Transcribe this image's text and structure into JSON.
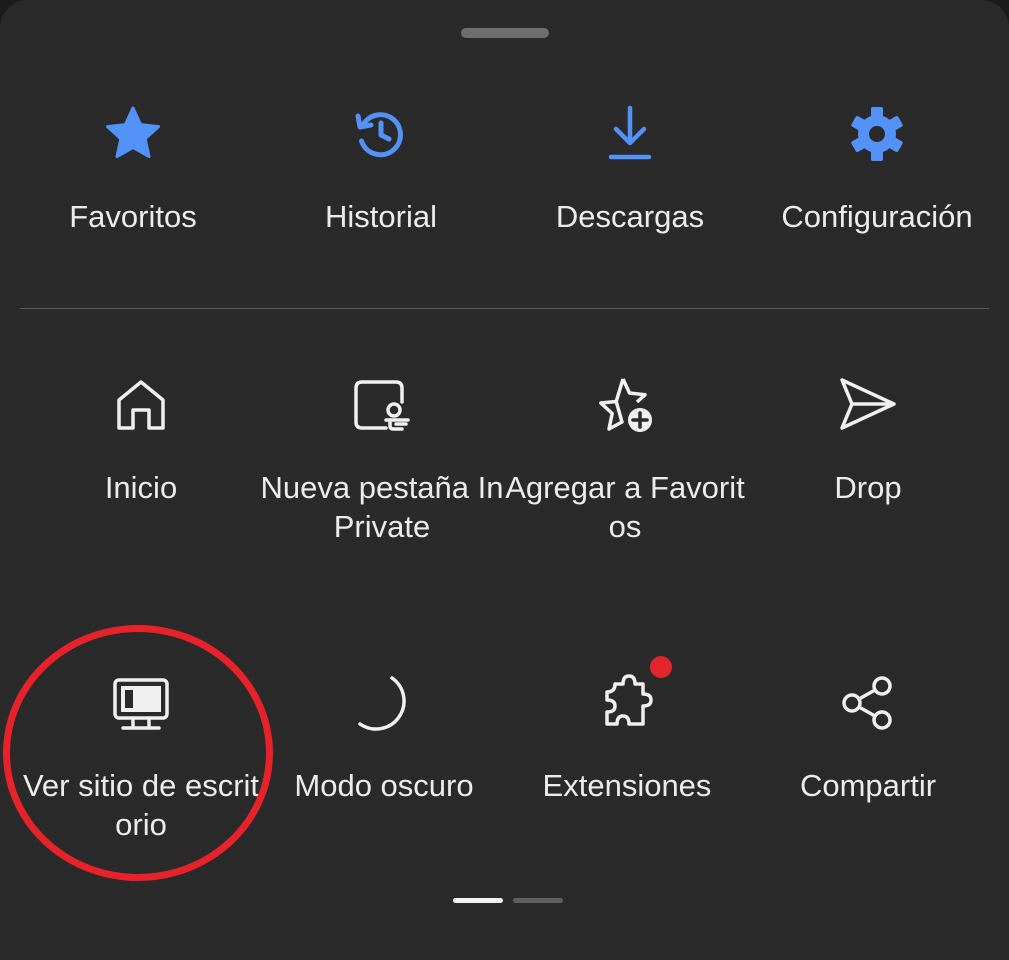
{
  "colors": {
    "accent": "#5392f6",
    "background": "#2a2a2b",
    "text": "#ececec",
    "badge": "#e2242b",
    "highlight": "#e8222b"
  },
  "row1": {
    "favorites": {
      "label": "Favoritos",
      "icon": "star-icon"
    },
    "history": {
      "label": "Historial",
      "icon": "history-icon"
    },
    "downloads": {
      "label": "Descargas",
      "icon": "download-icon"
    },
    "settings": {
      "label": "Configuración",
      "icon": "gear-icon"
    }
  },
  "row2": {
    "home": {
      "label": "Inicio",
      "icon": "home-icon"
    },
    "inprivate": {
      "label": "Nueva pestaña InPrivate",
      "icon": "inprivate-tab-icon"
    },
    "add_favorites": {
      "label": "Agregar a Favoritos",
      "icon": "star-add-icon"
    },
    "drop": {
      "label": "Drop",
      "icon": "send-icon"
    }
  },
  "row3": {
    "desktop_site": {
      "label": "Ver sitio de escritorio",
      "icon": "desktop-icon"
    },
    "dark_mode": {
      "label": "Modo oscuro",
      "icon": "moon-icon"
    },
    "extensions": {
      "label": "Extensiones",
      "icon": "puzzle-icon",
      "has_badge": true
    },
    "share": {
      "label": "Compartir",
      "icon": "share-icon"
    }
  },
  "pagination": {
    "pages": 2,
    "current": 1
  }
}
